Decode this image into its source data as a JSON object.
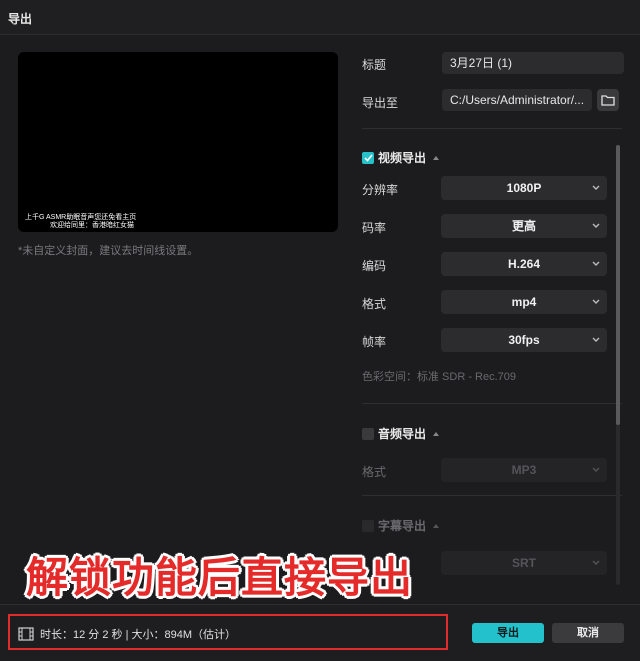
{
  "window": {
    "title": "导出"
  },
  "preview": {
    "caption_line1": "上千G ASMR助眠音声您还免看主页",
    "caption_line2": "欢迎给同里：香港暗红女猫",
    "hint": "*未自定义封面，建议去时间线设置。"
  },
  "fields": {
    "title_label": "标题",
    "title_value": "3月27日 (1)",
    "export_to_label": "导出至",
    "export_to_value": "C:/Users/Administrator/..."
  },
  "video": {
    "section_label": "视频导出",
    "resolution_label": "分辨率",
    "resolution_value": "1080P",
    "bitrate_label": "码率",
    "bitrate_value": "更高",
    "codec_label": "编码",
    "codec_value": "H.264",
    "format_label": "格式",
    "format_value": "mp4",
    "framerate_label": "帧率",
    "framerate_value": "30fps",
    "colorspace_text": "色彩空间：标准 SDR - Rec.709"
  },
  "audio": {
    "section_label": "音频导出",
    "format_label": "格式",
    "format_value": "MP3"
  },
  "subtitle": {
    "section_label": "字幕导出",
    "format_value": "SRT"
  },
  "banner": {
    "text": "解锁功能后直接导出"
  },
  "footer": {
    "info": "时长：12 分 2 秒 | 大小：894M（估计）",
    "export_label": "导出",
    "cancel_label": "取消"
  },
  "colors": {
    "accent": "#22c1cb",
    "highlight_red": "#e22b2b",
    "background": "#1c1c1e"
  }
}
